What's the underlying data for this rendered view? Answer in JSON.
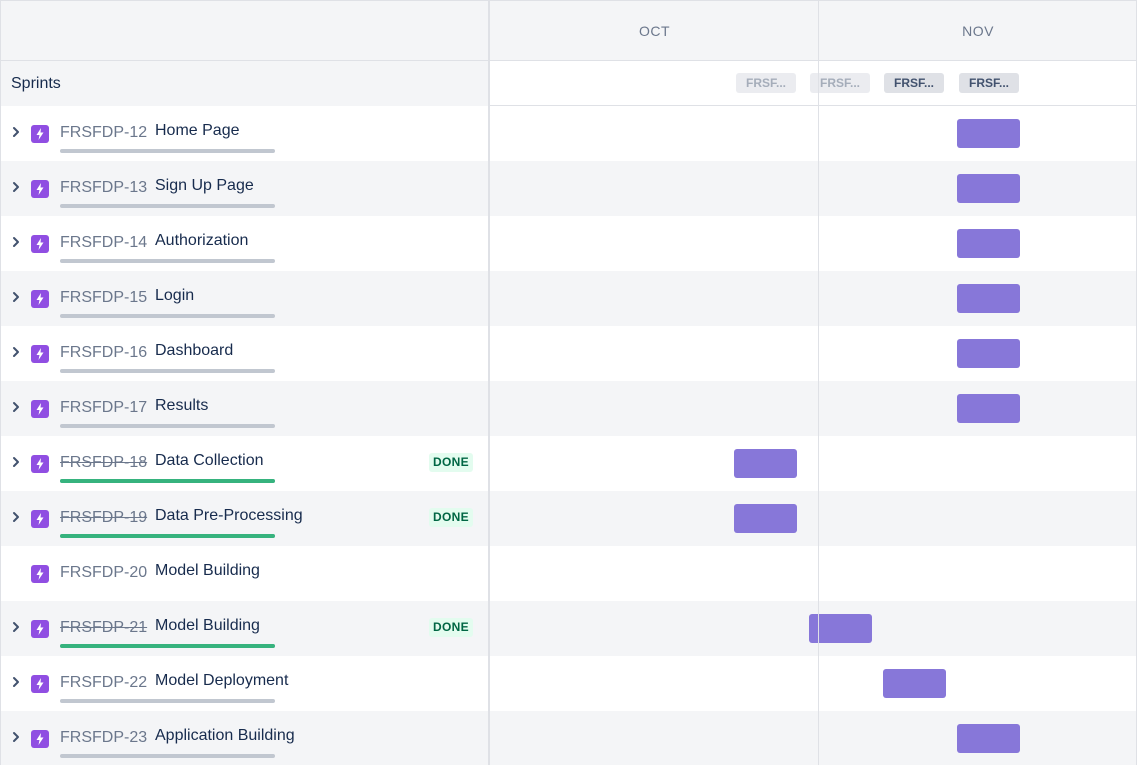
{
  "timeline": {
    "months": [
      "OCT",
      "NOV"
    ],
    "sprints_label": "Sprints",
    "sprint_chips": [
      "FRSF...",
      "FRSF...",
      "FRSF...",
      "FRSF..."
    ]
  },
  "issues": [
    {
      "key": "FRSFDP-12",
      "title": "Home Page",
      "status": "",
      "done": false,
      "progress": 0
    },
    {
      "key": "FRSFDP-13",
      "title": "Sign Up Page",
      "status": "",
      "done": false,
      "progress": 0
    },
    {
      "key": "FRSFDP-14",
      "title": "Authorization",
      "status": "",
      "done": false,
      "progress": 0
    },
    {
      "key": "FRSFDP-15",
      "title": "Login",
      "status": "",
      "done": false,
      "progress": 0
    },
    {
      "key": "FRSFDP-16",
      "title": "Dashboard",
      "status": "",
      "done": false,
      "progress": 0
    },
    {
      "key": "FRSFDP-17",
      "title": "Results",
      "status": "",
      "done": false,
      "progress": 0
    },
    {
      "key": "FRSFDP-18",
      "title": "Data Collection",
      "status": "DONE",
      "done": true,
      "progress": 1
    },
    {
      "key": "FRSFDP-19",
      "title": "Data Pre-Processing",
      "status": "DONE",
      "done": true,
      "progress": 1
    },
    {
      "key": "FRSFDP-20",
      "title": "Model Building",
      "status": "",
      "done": false,
      "progress": null
    },
    {
      "key": "FRSFDP-21",
      "title": "Model Building",
      "status": "DONE",
      "done": true,
      "progress": 1
    },
    {
      "key": "FRSFDP-22",
      "title": "Model Deployment",
      "status": "",
      "done": false,
      "progress": 0
    },
    {
      "key": "FRSFDP-23",
      "title": "Application Building",
      "status": "",
      "done": false,
      "progress": 0
    }
  ],
  "colors": {
    "epic_icon": "#904ee2",
    "bar": "#8777d9",
    "progress_done": "#36b37e",
    "progress_todo": "#c1c7d0",
    "done_badge_bg": "#e3fcef",
    "done_badge_text": "#006644"
  },
  "icons": {
    "expand": "chevron-right-icon",
    "issue_type": "epic-lightning-icon"
  }
}
